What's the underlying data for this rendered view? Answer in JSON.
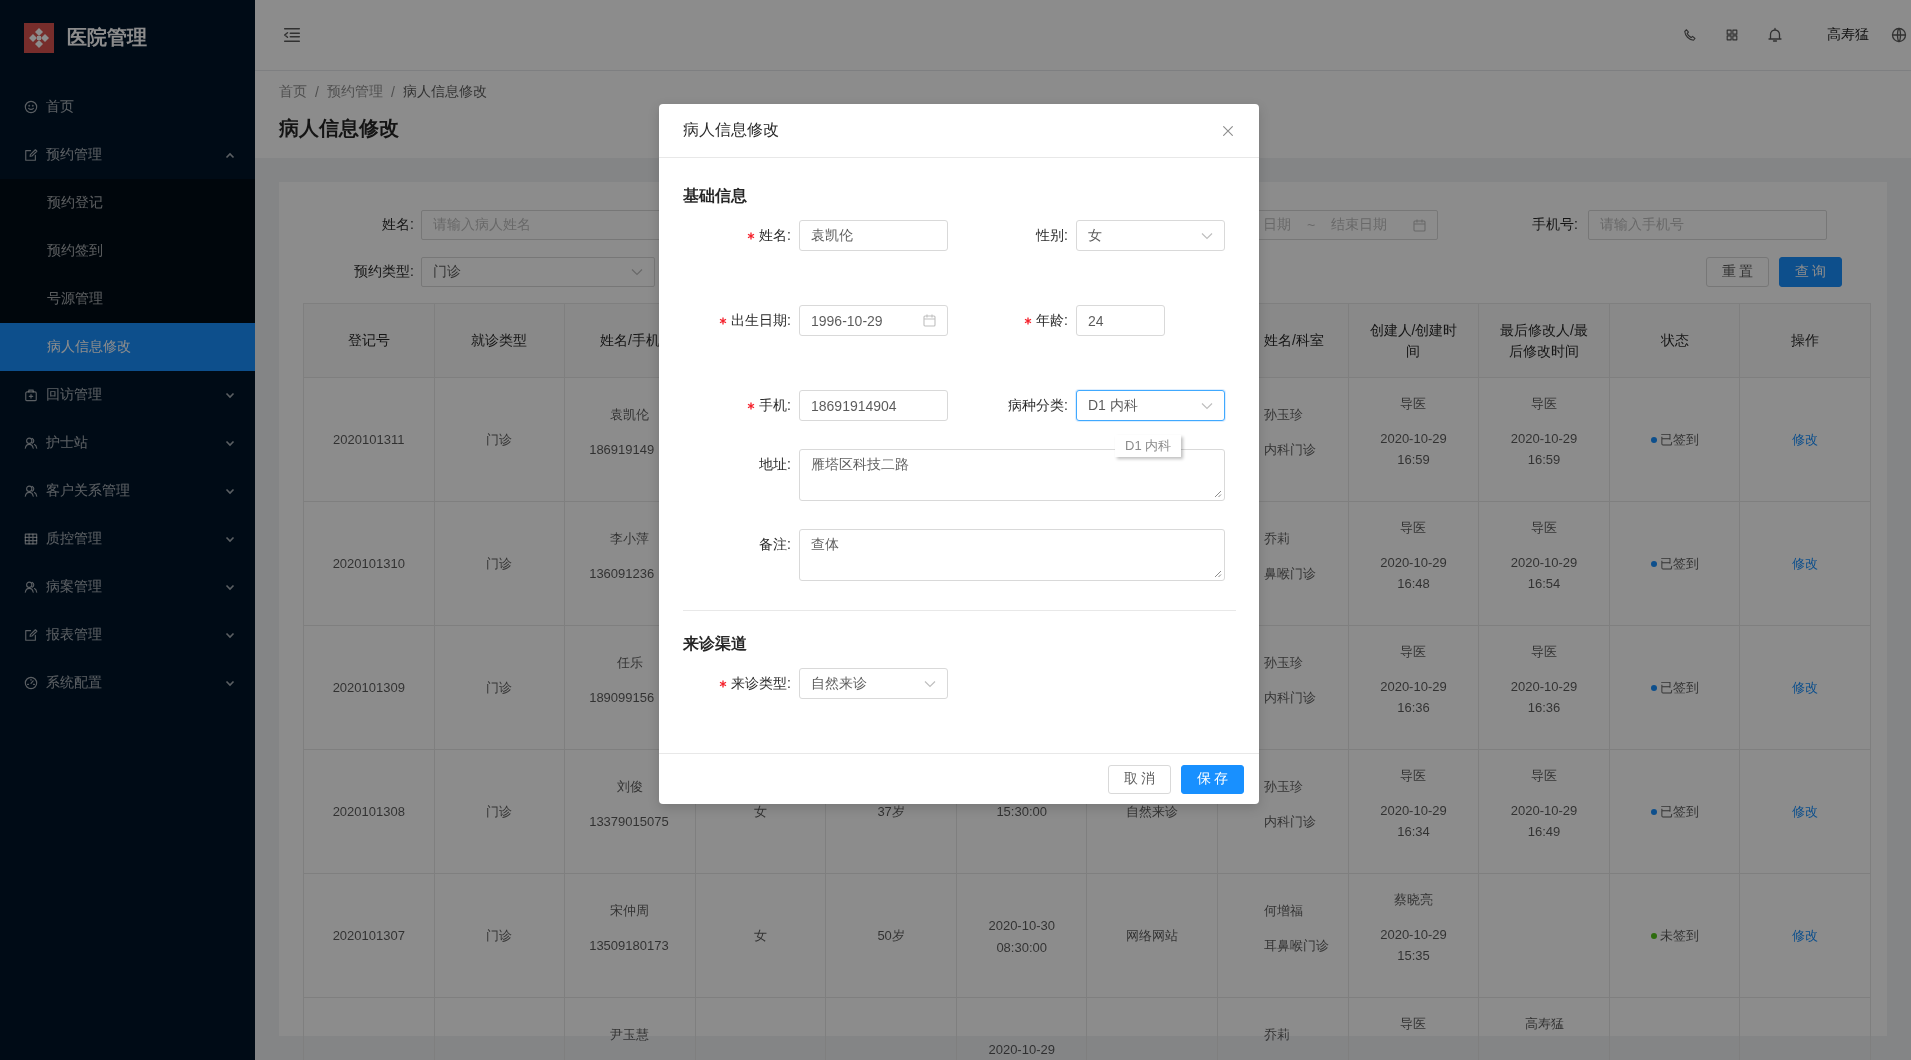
{
  "sidebar": {
    "title": "医院管理",
    "items": [
      {
        "kind": "link",
        "label": "首页",
        "selected": false
      },
      {
        "kind": "submenu",
        "label": "预约管理",
        "selected": false,
        "expanded": true,
        "children": [
          {
            "label": "预约登记",
            "selected": false
          },
          {
            "label": "预约签到",
            "selected": false
          },
          {
            "label": "号源管理",
            "selected": false
          },
          {
            "label": "病人信息修改",
            "selected": true
          }
        ]
      },
      {
        "kind": "submenu",
        "label": "回访管理",
        "selected": false,
        "expanded": false
      },
      {
        "kind": "submenu",
        "label": "护士站",
        "selected": false,
        "expanded": false
      },
      {
        "kind": "submenu",
        "label": "客户关系管理",
        "selected": false,
        "expanded": false
      },
      {
        "kind": "submenu",
        "label": "质控管理",
        "selected": false,
        "expanded": false
      },
      {
        "kind": "submenu",
        "label": "病案管理",
        "selected": false,
        "expanded": false
      },
      {
        "kind": "submenu",
        "label": "报表管理",
        "selected": false,
        "expanded": false
      },
      {
        "kind": "submenu",
        "label": "系统配置",
        "selected": false,
        "expanded": false
      }
    ]
  },
  "header": {
    "user": "高寿猛"
  },
  "breadcrumb": {
    "separator": "/",
    "items": [
      "首页",
      "预约管理",
      "病人信息修改"
    ]
  },
  "page_title": "病人信息修改",
  "filters": {
    "name": {
      "label": "姓名:",
      "placeholder": "请输入病人姓名"
    },
    "date_range": {
      "start_placeholder": "日期",
      "separator": "~",
      "end_placeholder": "结束日期"
    },
    "phone": {
      "label": "手机号:",
      "placeholder": "请输入手机号"
    },
    "type": {
      "label": "预约类型:",
      "value": "门诊"
    },
    "buttons": [
      {
        "label": "重 置",
        "primary": false
      },
      {
        "label": "查 询",
        "primary": true
      }
    ]
  },
  "table": {
    "columns": [
      "登记号",
      "就诊类型",
      "姓名/手机",
      null,
      null,
      null,
      null,
      "姓名/科室",
      "创建人/创建时间",
      "最后修改人/最后修改时间",
      "状态",
      "操作"
    ],
    "rows": [
      {
        "cells": [
          {
            "kind": "single",
            "text": "2020101311"
          },
          {
            "kind": "single",
            "text": "门诊"
          },
          {
            "kind": "pair",
            "lines": [
              "袁凯伦",
              "186919149"
            ]
          },
          null,
          null,
          null,
          null,
          {
            "kind": "pair",
            "lines": [
              "孙玉珍",
              "内科门诊"
            ]
          },
          {
            "kind": "person_time",
            "name": "导医",
            "lines": [
              "2020-10-29",
              "16:59"
            ]
          },
          {
            "kind": "person_time",
            "name": "导医",
            "lines": [
              "2020-10-29",
              "16:59"
            ]
          },
          {
            "kind": "status",
            "text": "已签到",
            "color": "#0d4f8c"
          },
          {
            "kind": "link",
            "text": "修改"
          }
        ]
      },
      {
        "cells": [
          {
            "kind": "single",
            "text": "2020101310"
          },
          {
            "kind": "single",
            "text": "门诊"
          },
          {
            "kind": "pair",
            "lines": [
              "李小萍",
              "136091236"
            ]
          },
          null,
          null,
          null,
          null,
          {
            "kind": "pair",
            "lines": [
              "乔莉",
              "鼻喉门诊"
            ]
          },
          {
            "kind": "person_time",
            "name": "导医",
            "lines": [
              "2020-10-29",
              "16:48"
            ]
          },
          {
            "kind": "person_time",
            "name": "导医",
            "lines": [
              "2020-10-29",
              "16:54"
            ]
          },
          {
            "kind": "status",
            "text": "已签到",
            "color": "#0d4f8c"
          },
          {
            "kind": "link",
            "text": "修改"
          }
        ]
      },
      {
        "cells": [
          {
            "kind": "single",
            "text": "2020101309"
          },
          {
            "kind": "single",
            "text": "门诊"
          },
          {
            "kind": "pair",
            "lines": [
              "任乐",
              "189099156"
            ]
          },
          null,
          null,
          null,
          null,
          {
            "kind": "pair",
            "lines": [
              "孙玉珍",
              "内科门诊"
            ]
          },
          {
            "kind": "person_time",
            "name": "导医",
            "lines": [
              "2020-10-29",
              "16:36"
            ]
          },
          {
            "kind": "person_time",
            "name": "导医",
            "lines": [
              "2020-10-29",
              "16:36"
            ]
          },
          {
            "kind": "status",
            "text": "已签到",
            "color": "#0d4f8c"
          },
          {
            "kind": "link",
            "text": "修改"
          }
        ]
      },
      {
        "cells": [
          {
            "kind": "single",
            "text": "2020101308"
          },
          {
            "kind": "single",
            "text": "门诊"
          },
          {
            "kind": "pair",
            "lines": [
              "刘俊",
              "13379015075"
            ]
          },
          {
            "kind": "single",
            "text": "女"
          },
          {
            "kind": "single",
            "text": "37岁"
          },
          {
            "kind": "single",
            "text": "15:30:00"
          },
          {
            "kind": "single",
            "text": "自然来诊"
          },
          {
            "kind": "pair",
            "lines": [
              "孙玉珍",
              "内科门诊"
            ]
          },
          {
            "kind": "person_time",
            "name": "导医",
            "lines": [
              "2020-10-29",
              "16:34"
            ]
          },
          {
            "kind": "person_time",
            "name": "导医",
            "lines": [
              "2020-10-29",
              "16:49"
            ]
          },
          {
            "kind": "status",
            "text": "已签到",
            "color": "#0d4f8c"
          },
          {
            "kind": "link",
            "text": "修改"
          }
        ]
      },
      {
        "cells": [
          {
            "kind": "single",
            "text": "2020101307"
          },
          {
            "kind": "single",
            "text": "门诊"
          },
          {
            "kind": "pair",
            "lines": [
              "宋仲周",
              "13509180173"
            ]
          },
          {
            "kind": "single",
            "text": "女"
          },
          {
            "kind": "single",
            "text": "50岁"
          },
          {
            "kind": "stack",
            "lines": [
              "2020-10-30",
              "08:30:00"
            ]
          },
          {
            "kind": "single",
            "text": "网络网站"
          },
          {
            "kind": "pair",
            "lines": [
              "何增福",
              "耳鼻喉门诊"
            ]
          },
          {
            "kind": "person_time",
            "name": "蔡晓亮",
            "lines": [
              "2020-10-29",
              "15:35"
            ]
          },
          null,
          {
            "kind": "status",
            "text": "未签到",
            "color": "#2d6c0e"
          },
          {
            "kind": "link",
            "text": "修改"
          }
        ]
      },
      {
        "cells": [
          null,
          null,
          {
            "kind": "pair",
            "lines": [
              "尹玉慧"
            ]
          },
          null,
          null,
          {
            "kind": "stack",
            "lines": [
              "2020-10-29"
            ]
          },
          null,
          {
            "kind": "pair",
            "lines": [
              "乔莉"
            ]
          },
          {
            "kind": "person_time",
            "name": "导医"
          },
          {
            "kind": "person_time",
            "name": "高寿猛"
          },
          null,
          null
        ]
      }
    ]
  },
  "modal": {
    "title": "病人信息修改",
    "sections": [
      {
        "title": "基础信息",
        "fields": [
          {
            "kind": "input",
            "label": "姓名:",
            "required": true,
            "value": "袁凯伦",
            "focused": false
          },
          {
            "kind": "select",
            "label": "性别:",
            "required": false,
            "value": "女",
            "focused": false
          },
          {
            "kind": "date",
            "label": "出生日期:",
            "required": true,
            "value": "1996-10-29",
            "focused": false
          },
          {
            "kind": "number",
            "label": "年龄:",
            "required": true,
            "value": "24",
            "focused": false
          },
          {
            "kind": "input",
            "label": "手机:",
            "required": true,
            "value": "18691914904",
            "focused": false
          },
          {
            "kind": "select",
            "label": "病种分类:",
            "required": false,
            "value": "D1 内科",
            "focused": true,
            "tooltip": "D1 内科"
          },
          {
            "kind": "textarea",
            "label": "地址:",
            "required": false,
            "value": "雁塔区科技二路",
            "focused": false
          },
          {
            "kind": "textarea",
            "label": "备注:",
            "required": false,
            "value": "查体",
            "focused": false
          }
        ]
      },
      {
        "title": "来诊渠道",
        "fields": [
          {
            "kind": "select",
            "label": "来诊类型:",
            "required": true,
            "value": "自然来诊",
            "focused": false
          }
        ]
      }
    ],
    "buttons": [
      {
        "label": "取 消",
        "primary": false
      },
      {
        "label": "保 存",
        "primary": true
      }
    ]
  }
}
